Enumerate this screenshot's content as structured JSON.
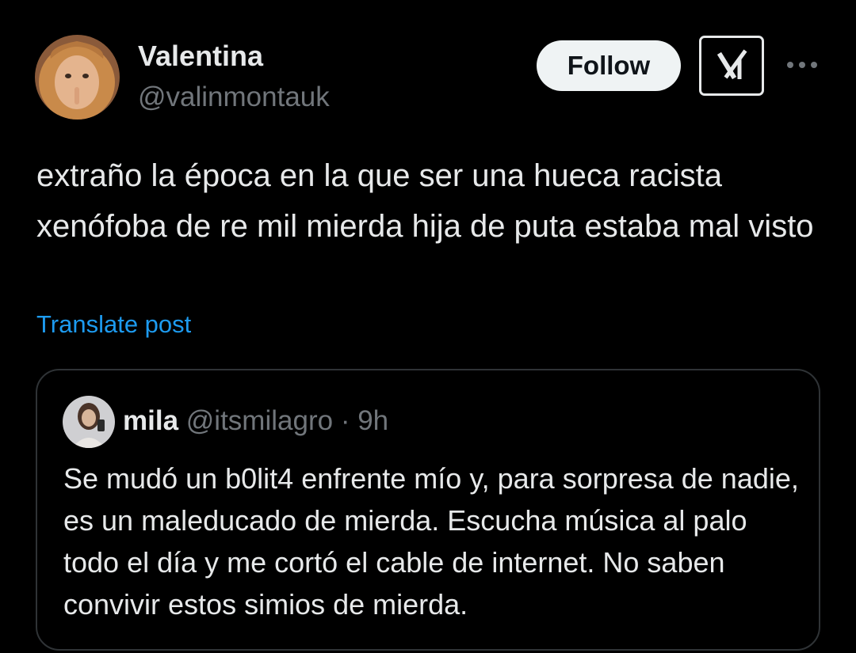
{
  "author": {
    "name": "Valentina",
    "handle": "@valinmontauk"
  },
  "actions": {
    "follow_label": "Follow",
    "grok_icon": "grok-icon",
    "more_icon": "more-icon"
  },
  "post": {
    "text": "extraño la época en la que ser una hueca racista xenófoba de re mil mierda hija de puta estaba mal visto",
    "translate_label": "Translate post"
  },
  "quoted_post": {
    "name": "mila",
    "handle": "@itsmilagro",
    "separator": "·",
    "time": "9h",
    "text": "Se mudó un b0lit4 enfrente mío y, para sorpresa de nadie, es un maleducado de mierda. Escucha música al palo todo el día y me cortó el cable de internet. No saben convivir estos simios de mierda."
  },
  "colors": {
    "background": "#000000",
    "text_primary": "#e7e9ea",
    "text_secondary": "#71767b",
    "link": "#1d9bf0",
    "border": "#2f3336",
    "button_bg": "#eff3f4"
  }
}
